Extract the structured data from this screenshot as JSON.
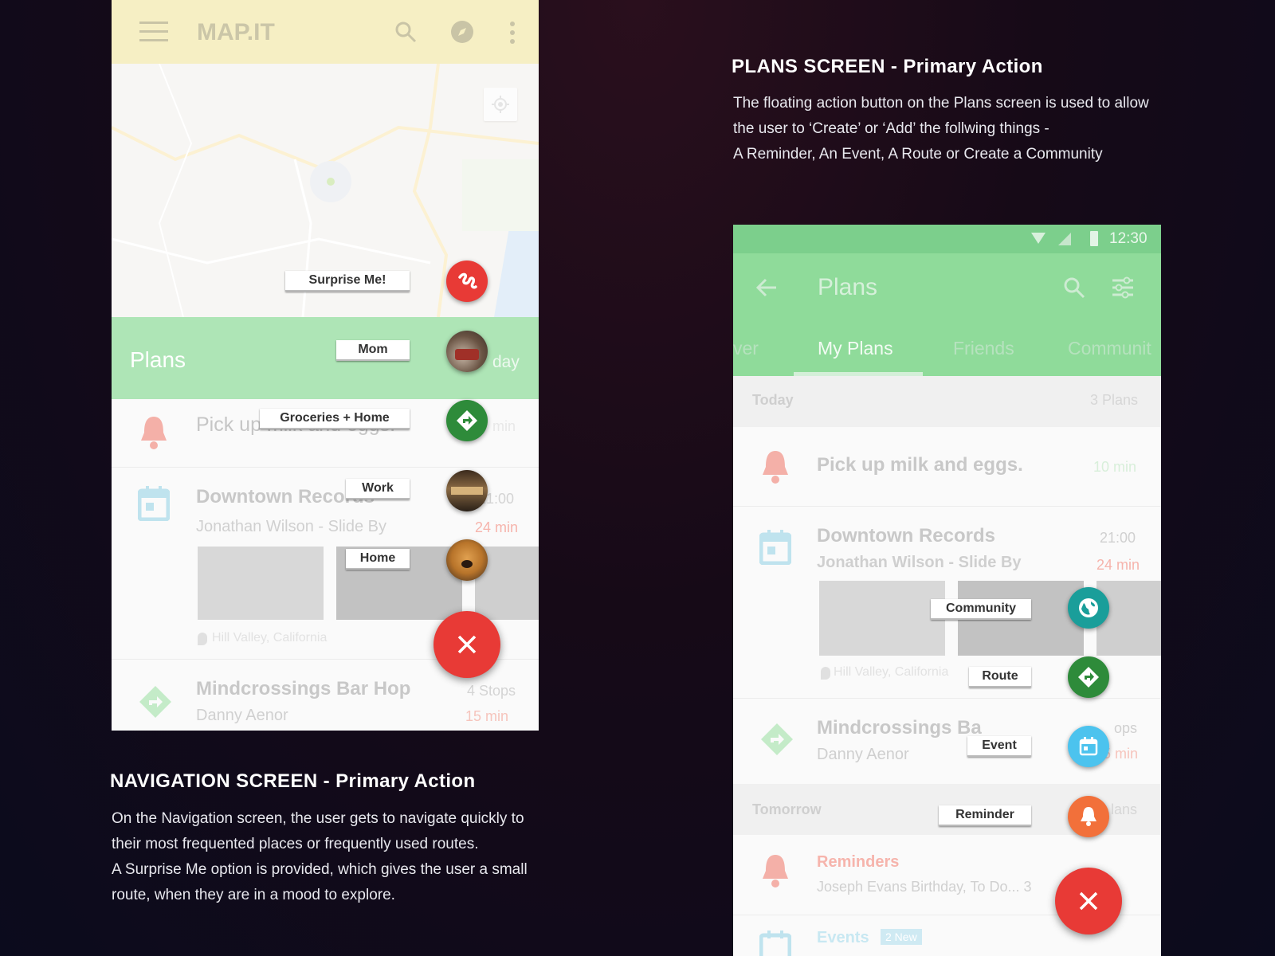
{
  "colors": {
    "background": "#120b1a",
    "appbar_yellow": "#f6efc4",
    "plans_green": "#8fdb9a",
    "fab_red": "#e83a36",
    "fab_green": "#2e8b3a",
    "fab_teal": "#1a9e9a",
    "fab_blue": "#4cc3ee",
    "fab_orange": "#f2703a"
  },
  "navigation_screen": {
    "app_title": "MAP.IT",
    "icons": [
      "menu-icon",
      "search-icon",
      "compass-icon",
      "more-vert-icon",
      "my-location-icon"
    ],
    "plans_bar_title": "Plans",
    "plans_bar_partial": "day",
    "list": [
      {
        "title": "Pick up milk and eggs.",
        "meta": "min",
        "icon": "bell-icon"
      },
      {
        "title": "Downtown Records",
        "subtitle": "Jonathan Wilson - Slide By",
        "time": "21:00",
        "eta": "24 min",
        "location": "Hill Valley, California",
        "icon": "calendar-icon"
      },
      {
        "title": "Mindcrossings Bar Hop",
        "subtitle": "Danny Aenor",
        "meta": "4 Stops",
        "eta": "15 min",
        "icon": "route-icon"
      }
    ],
    "speed_dial": [
      {
        "label": "Surprise Me!",
        "icon": "squiggle-route-icon",
        "color": "#e83a36"
      },
      {
        "label": "Mom",
        "icon": "photo-mom",
        "color": "#5a4a3a"
      },
      {
        "label": "Groceries + Home",
        "icon": "directions-icon",
        "color": "#2e8b3a"
      },
      {
        "label": "Work",
        "icon": "photo-work",
        "color": "#6b4a2a"
      },
      {
        "label": "Home",
        "icon": "photo-dog",
        "color": "#b8742a"
      }
    ],
    "close_fab_icon": "close-icon"
  },
  "plans_screen": {
    "status_time": "12:30",
    "title": "Plans",
    "tabs": [
      "ver",
      "My Plans",
      "Friends",
      "Communit"
    ],
    "active_tab": "My Plans",
    "sections": [
      {
        "label": "Today",
        "count": "3 Plans"
      },
      {
        "label": "Tomorrow",
        "count": "lans"
      }
    ],
    "items": [
      {
        "title": "Pick up milk and eggs.",
        "meta": "10 min",
        "icon": "bell-icon"
      },
      {
        "title": "Downtown Records",
        "subtitle": "Jonathan Wilson - Slide By",
        "time": "21:00",
        "eta": "24 min",
        "location": "Hill Valley, California",
        "icon": "calendar-icon"
      },
      {
        "title": "Mindcrossings Ba",
        "subtitle": "Danny Aenor",
        "meta": "ops",
        "eta": "15 min",
        "icon": "route-icon"
      },
      {
        "title": "Reminders",
        "subtitle": "Joseph Evans Birthday, To Do... 3",
        "icon": "bell-icon"
      },
      {
        "title": "Events",
        "badge": "2 New",
        "icon": "calendar-icon"
      }
    ],
    "speed_dial": [
      {
        "label": "Community",
        "icon": "globe-icon",
        "color": "#1a9e9a"
      },
      {
        "label": "Route",
        "icon": "directions-icon",
        "color": "#2e8b3a"
      },
      {
        "label": "Event",
        "icon": "calendar-icon",
        "color": "#4cc3ee"
      },
      {
        "label": "Reminder",
        "icon": "bell-icon",
        "color": "#f2703a"
      }
    ],
    "close_fab_icon": "close-icon"
  },
  "descriptions": {
    "plans": {
      "title": "PLANS SCREEN - Primary Action",
      "line1": "The floating action button on the Plans screen is used to allow",
      "line2": "the user to ‘Create’ or ‘Add’ the follwing things -",
      "line3": "A Reminder, An Event, A Route or Create a Community"
    },
    "navigation": {
      "title": "NAVIGATION SCREEN - Primary Action",
      "line1": "On the Navigation screen, the user gets to navigate quickly to",
      "line2": "their most frequented places or frequently used routes.",
      "line3": "A Surprise Me option is provided, which gives the user a small",
      "line4": "route, when they are in a mood to explore."
    }
  }
}
